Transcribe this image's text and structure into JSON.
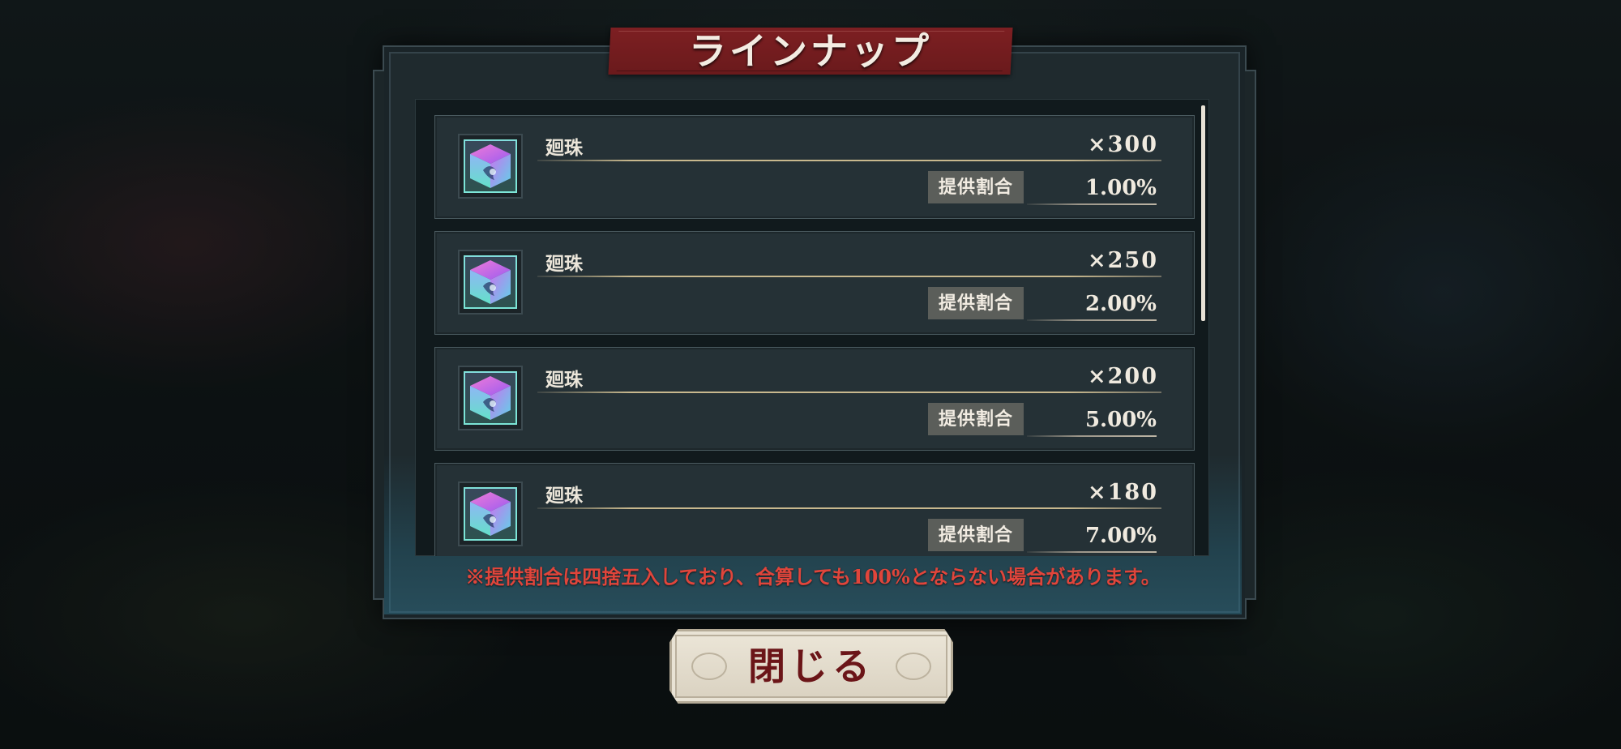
{
  "dialog": {
    "title": "ラインナップ",
    "rate_label": "提供割合",
    "items": [
      {
        "name": "廻珠",
        "quantity": "×300",
        "rate": "1.00%",
        "icon": "crystal-cube-icon"
      },
      {
        "name": "廻珠",
        "quantity": "×250",
        "rate": "2.00%",
        "icon": "crystal-cube-icon"
      },
      {
        "name": "廻珠",
        "quantity": "×200",
        "rate": "5.00%",
        "icon": "crystal-cube-icon"
      },
      {
        "name": "廻珠",
        "quantity": "×180",
        "rate": "7.00%",
        "icon": "crystal-cube-icon"
      }
    ],
    "footnote": "※提供割合は四捨五入しており、合算しても100%とならない場合があります。",
    "close_label": "閉じる"
  },
  "colors": {
    "title_banner": "#7d1f22",
    "footnote": "#e0453b",
    "close_text": "#6b1518"
  }
}
